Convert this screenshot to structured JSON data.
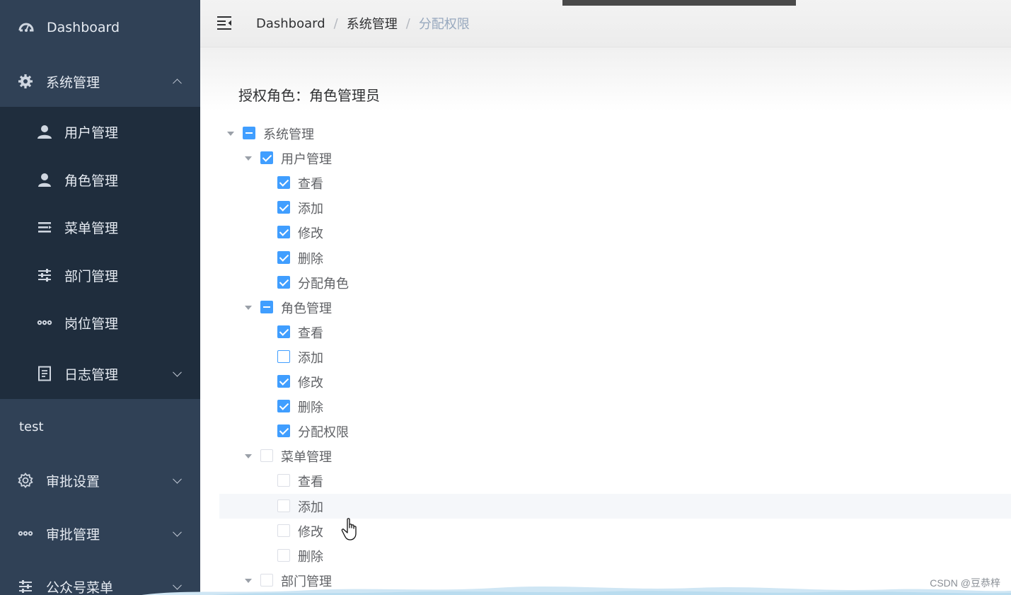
{
  "sidebar": {
    "dashboard": "Dashboard",
    "system": "系统管理",
    "sub": {
      "users": "用户管理",
      "roles": "角色管理",
      "menus": "菜单管理",
      "depts": "部门管理",
      "posts": "岗位管理",
      "logs": "日志管理"
    },
    "test": "test",
    "approval_settings": "审批设置",
    "approval_manage": "审批管理",
    "wechat_menu": "公众号菜单"
  },
  "header": {
    "breadcrumb": [
      "Dashboard",
      "系统管理",
      "分配权限"
    ],
    "separator": "/"
  },
  "main": {
    "role_title": "授权角色：角色管理员"
  },
  "tree": [
    {
      "label": "系统管理",
      "level": 0,
      "state": "indeterminate",
      "expandable": true
    },
    {
      "label": "用户管理",
      "level": 1,
      "state": "checked",
      "expandable": true
    },
    {
      "label": "查看",
      "level": 2,
      "state": "checked"
    },
    {
      "label": "添加",
      "level": 2,
      "state": "checked"
    },
    {
      "label": "修改",
      "level": 2,
      "state": "checked"
    },
    {
      "label": "删除",
      "level": 2,
      "state": "checked"
    },
    {
      "label": "分配角色",
      "level": 2,
      "state": "checked"
    },
    {
      "label": "角色管理",
      "level": 1,
      "state": "indeterminate",
      "expandable": true
    },
    {
      "label": "查看",
      "level": 2,
      "state": "checked"
    },
    {
      "label": "添加",
      "level": 2,
      "state": "unchecked-focus"
    },
    {
      "label": "修改",
      "level": 2,
      "state": "checked"
    },
    {
      "label": "删除",
      "level": 2,
      "state": "checked"
    },
    {
      "label": "分配权限",
      "level": 2,
      "state": "checked"
    },
    {
      "label": "菜单管理",
      "level": 1,
      "state": "unchecked",
      "expandable": true
    },
    {
      "label": "查看",
      "level": 2,
      "state": "unchecked"
    },
    {
      "label": "添加",
      "level": 2,
      "state": "unchecked",
      "hover": true
    },
    {
      "label": "修改",
      "level": 2,
      "state": "unchecked"
    },
    {
      "label": "删除",
      "level": 2,
      "state": "unchecked"
    },
    {
      "label": "部门管理",
      "level": 1,
      "state": "unchecked",
      "expandable": true
    }
  ],
  "watermark": "CSDN @豆恭梓",
  "colors": {
    "sidebar_bg": "#304156",
    "submenu_bg": "#1f2d3d",
    "checkbox_primary": "#409eff",
    "breadcrumb_last": "#97a8be"
  }
}
